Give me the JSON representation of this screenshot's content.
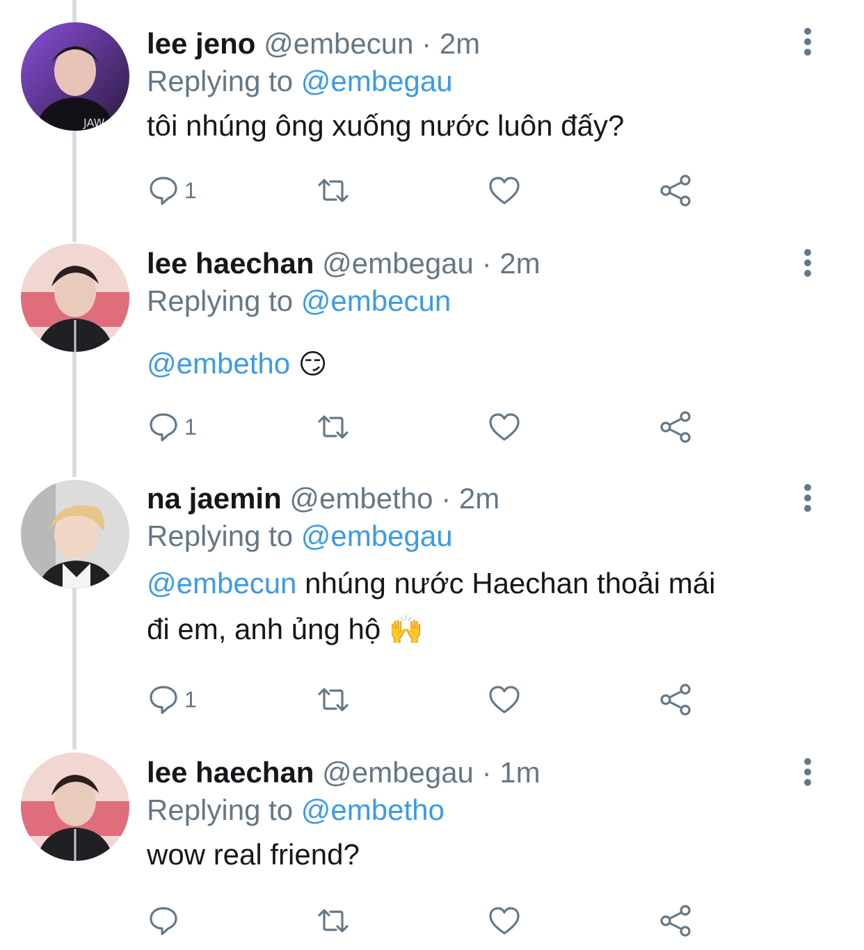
{
  "tweets": [
    {
      "display_name": "lee jeno",
      "handle": "@embecun",
      "time": "· 2m",
      "replying_prefix": "Replying to",
      "replying_to": "@embegau",
      "text": "tôi nhúng ông xuống nước luôn đấy?",
      "mention": "",
      "emoji": "",
      "reply_count": "1",
      "avatar_icon": "avatar-purple-selfie"
    },
    {
      "display_name": "lee haechan",
      "handle": "@embegau",
      "time": "· 2m",
      "replying_prefix": "Replying to",
      "replying_to": "@embecun",
      "text": "",
      "mention": "@embetho",
      "emoji": "😏",
      "reply_count": "1",
      "avatar_icon": "avatar-pink-selfie"
    },
    {
      "display_name": "na jaemin",
      "handle": "@embetho",
      "time": "· 2m",
      "replying_prefix": "Replying to",
      "replying_to": "@embegau",
      "text_line1": "nhúng nước Haechan thoải mái",
      "text_line2": "đi em, anh ủng hộ",
      "mention": "@embecun",
      "emoji": "🙌",
      "reply_count": "1",
      "avatar_icon": "avatar-blond-selfie"
    },
    {
      "display_name": "lee haechan",
      "handle": "@embegau",
      "time": "· 1m",
      "replying_prefix": "Replying to",
      "replying_to": "@embetho",
      "text": "wow real friend?",
      "mention": "",
      "emoji": "",
      "reply_count": "",
      "avatar_icon": "avatar-pink-selfie"
    }
  ],
  "colors": {
    "link": "#3b9be6",
    "secondary": "#657786",
    "thread_line": "#d8dde2"
  }
}
